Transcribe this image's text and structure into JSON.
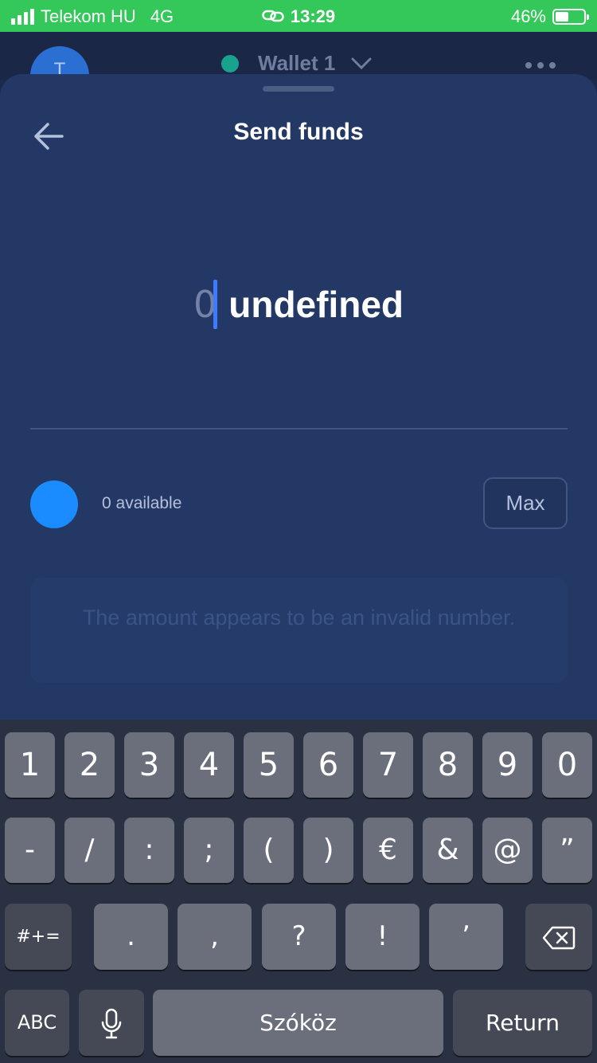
{
  "status_bar": {
    "carrier": "Telekom HU",
    "network": "4G",
    "time": "13:29",
    "battery": "46%",
    "battery_level": 0.46
  },
  "background_header": {
    "avatar_initial": "T",
    "wallet_name": "Wallet 1"
  },
  "sheet": {
    "title": "Send funds",
    "amount_value": "0",
    "amount_unit": "undefined",
    "available_text": "0 available",
    "max_label": "Max",
    "error_message": "The amount appears to be an invalid number."
  },
  "keyboard": {
    "row1": [
      "1",
      "2",
      "3",
      "4",
      "5",
      "6",
      "7",
      "8",
      "9",
      "0"
    ],
    "row2": [
      "-",
      "/",
      ":",
      ";",
      "(",
      ")",
      "€",
      "&",
      "@",
      "”"
    ],
    "row3": {
      "shift_label": "#+=",
      "keys": [
        ".",
        ",",
        "?",
        "!",
        "’"
      ]
    },
    "row4": {
      "abc_label": "ABC",
      "space_label": "Szóköz",
      "return_label": "Return"
    }
  },
  "colors": {
    "status_bar": "#34c759",
    "sheet": "#243865",
    "accent_caret": "#3d7bff",
    "token_icon": "#1a8cff",
    "wallet_dot": "#19a38f"
  }
}
